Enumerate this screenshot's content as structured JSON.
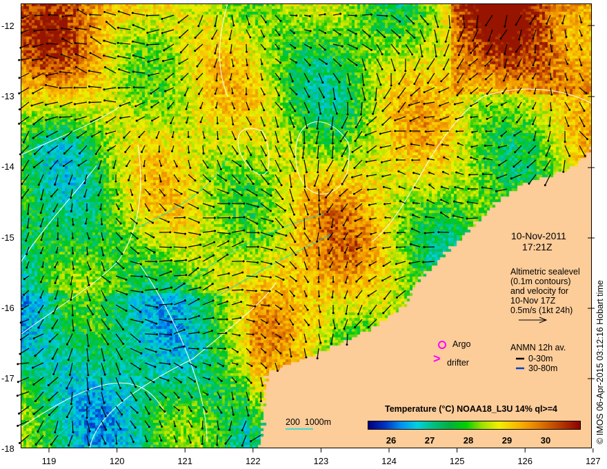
{
  "map": {
    "lon_ticks": [
      "119",
      "120",
      "121",
      "122",
      "123",
      "124",
      "125",
      "126",
      "127"
    ],
    "lat_ticks": [
      "-12",
      "-13",
      "-14",
      "-15",
      "-16",
      "-17",
      "-18"
    ],
    "lon_range": [
      118.58,
      127.0
    ],
    "lat_range": [
      -11.69,
      -18.0
    ],
    "colors": {
      "land": "#fccc99",
      "contour": "#ffffff",
      "isobath": "#00e0e0",
      "marker": "#ff00ff"
    }
  },
  "annotations": {
    "date": "10-Nov-2011",
    "time": "17:21Z",
    "altimetry": [
      "Altimetric sealevel",
      "(0.1m contours)",
      "and velocity for",
      "10-Nov 17Z",
      "0.5m/s (1kt 24h)"
    ],
    "anmn_title": "ANMN 12h av.",
    "anmn_shallow": "0-30m",
    "anmn_deep": "30-80m",
    "argo_label": "Argo",
    "drifter_label": "drifter",
    "drifter_symbol": ">",
    "isobath_label": "200  1000m"
  },
  "colorbar": {
    "title": "Temperature (°C) NOAA18_L3U 14% ql>=4",
    "ticks": [
      "26",
      "27",
      "28",
      "29",
      "30"
    ],
    "range": [
      25.4,
      30.8
    ]
  },
  "credit": "© IMOS 06-Apr-2015 03:12:16 Hobart time"
}
